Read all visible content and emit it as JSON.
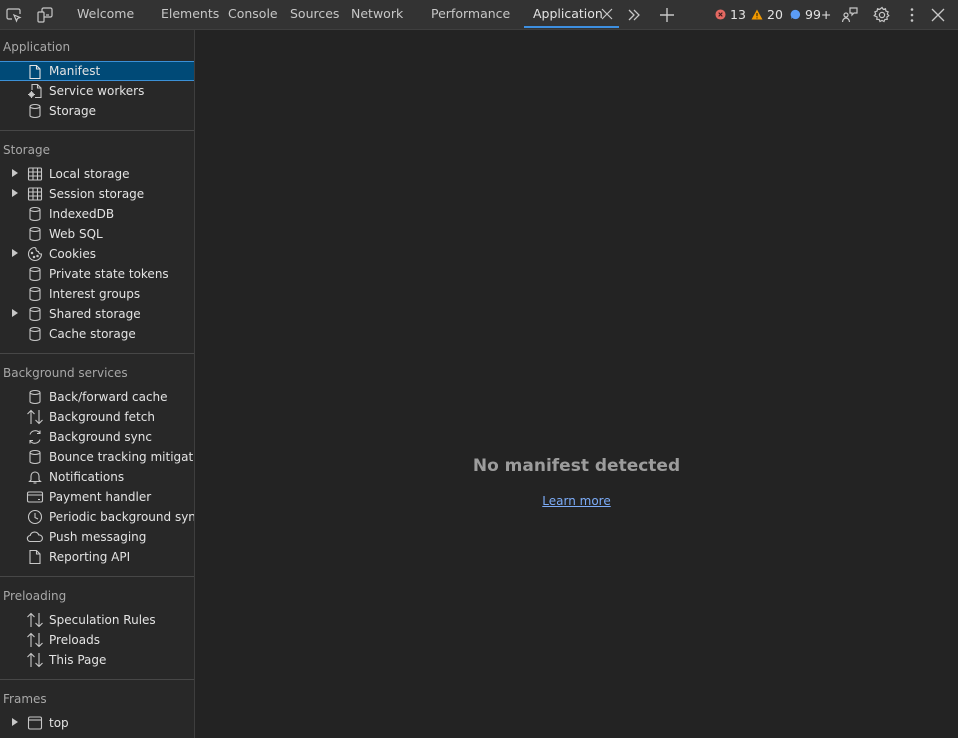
{
  "toolbar": {
    "inspect_icon": "inspect-element-icon",
    "device_icon": "device-toolbar-icon",
    "tabs": [
      {
        "label": "Welcome"
      },
      {
        "label": "Elements"
      },
      {
        "label": "Console"
      },
      {
        "label": "Sources"
      },
      {
        "label": "Network"
      },
      {
        "label": "Performance"
      },
      {
        "label": "Application",
        "active": true
      }
    ],
    "more_tabs_icon": "chevron-double-right-icon",
    "new_tab_icon": "plus-icon",
    "errors": "13",
    "warnings": "20",
    "issues": "99+",
    "colors": {
      "error": "#e46962",
      "warning": "#f29900",
      "issue": "#5b9cf5",
      "active_tab_underline": "#3d8fe0"
    }
  },
  "sidebar": {
    "sections": [
      {
        "title": "Application",
        "items": [
          {
            "label": "Manifest",
            "icon": "document-icon",
            "selected": true
          },
          {
            "label": "Service workers",
            "icon": "service-worker-icon"
          },
          {
            "label": "Storage",
            "icon": "database-icon"
          }
        ]
      },
      {
        "title": "Storage",
        "items": [
          {
            "label": "Local storage",
            "icon": "table-icon",
            "expandable": true
          },
          {
            "label": "Session storage",
            "icon": "table-icon",
            "expandable": true
          },
          {
            "label": "IndexedDB",
            "icon": "database-icon"
          },
          {
            "label": "Web SQL",
            "icon": "database-icon"
          },
          {
            "label": "Cookies",
            "icon": "cookie-icon",
            "expandable": true
          },
          {
            "label": "Private state tokens",
            "icon": "database-icon"
          },
          {
            "label": "Interest groups",
            "icon": "database-icon"
          },
          {
            "label": "Shared storage",
            "icon": "database-icon",
            "expandable": true
          },
          {
            "label": "Cache storage",
            "icon": "database-icon"
          }
        ]
      },
      {
        "title": "Background services",
        "items": [
          {
            "label": "Back/forward cache",
            "icon": "database-icon"
          },
          {
            "label": "Background fetch",
            "icon": "up-down-arrows-icon"
          },
          {
            "label": "Background sync",
            "icon": "sync-icon"
          },
          {
            "label": "Bounce tracking mitigations",
            "icon": "database-icon"
          },
          {
            "label": "Notifications",
            "icon": "bell-icon"
          },
          {
            "label": "Payment handler",
            "icon": "credit-card-icon"
          },
          {
            "label": "Periodic background sync",
            "icon": "clock-icon"
          },
          {
            "label": "Push messaging",
            "icon": "cloud-icon"
          },
          {
            "label": "Reporting API",
            "icon": "document-icon"
          }
        ]
      },
      {
        "title": "Preloading",
        "items": [
          {
            "label": "Speculation Rules",
            "icon": "up-down-arrows-icon"
          },
          {
            "label": "Preloads",
            "icon": "up-down-arrows-icon"
          },
          {
            "label": "This Page",
            "icon": "up-down-arrows-icon"
          }
        ]
      },
      {
        "title": "Frames",
        "items": [
          {
            "label": "top",
            "icon": "frame-icon",
            "expandable": true
          }
        ]
      }
    ]
  },
  "main": {
    "empty_title": "No manifest detected",
    "learn_more": "Learn more"
  }
}
